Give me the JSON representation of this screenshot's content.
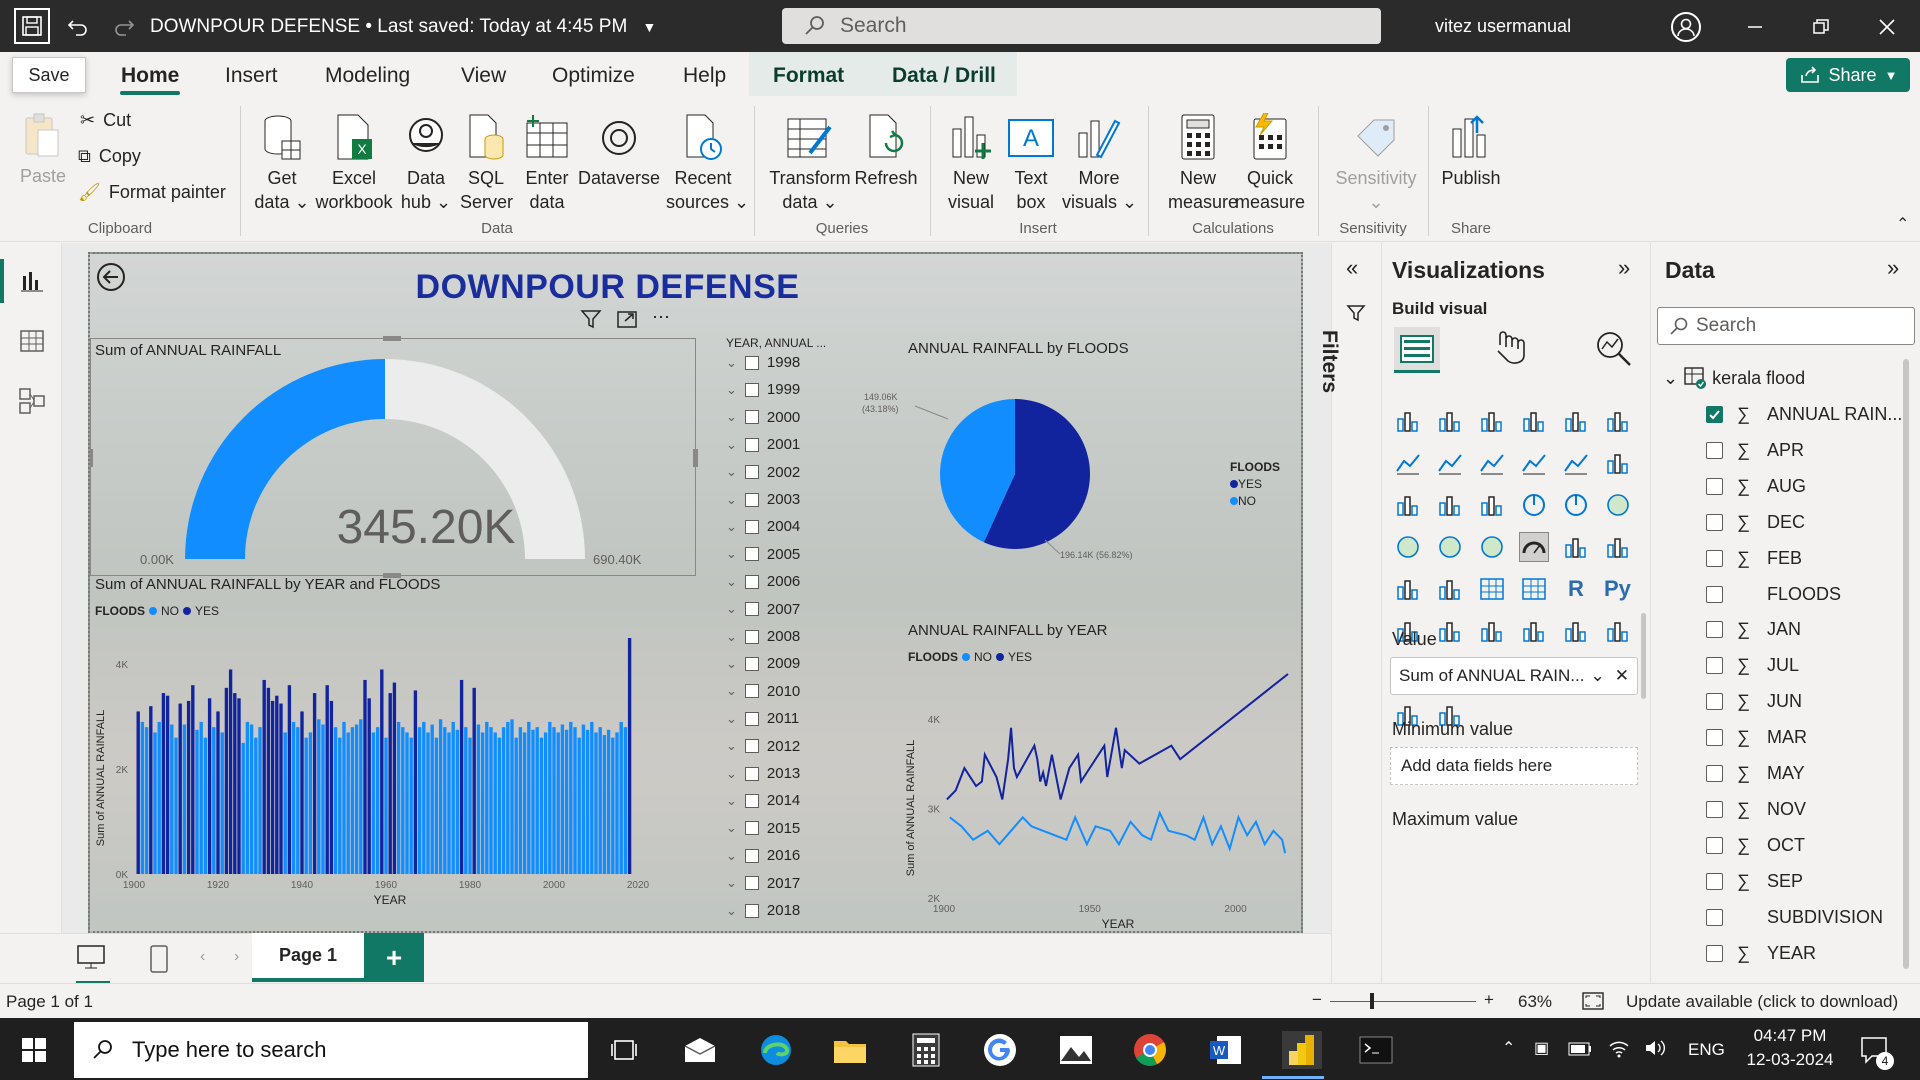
{
  "titlebar": {
    "doc_title": "DOWNPOUR DEFENSE",
    "saved_status": "Last saved: Today at 4:45 PM",
    "search_placeholder": "Search",
    "user_name": "vitez usermanual",
    "save_tooltip": "Save"
  },
  "menu": {
    "tabs": [
      "Home",
      "Insert",
      "Modeling",
      "View",
      "Optimize",
      "Help",
      "Format",
      "Data / Drill"
    ],
    "active": "Home",
    "share_label": "Share"
  },
  "ribbon": {
    "clipboard": {
      "paste": "Paste",
      "cut": "Cut",
      "copy": "Copy",
      "format_painter": "Format painter",
      "group": "Clipboard"
    },
    "data": {
      "get_data": [
        "Get",
        "data"
      ],
      "excel": [
        "Excel",
        "workbook"
      ],
      "data_hub": [
        "Data",
        "hub"
      ],
      "sql": [
        "SQL",
        "Server"
      ],
      "enter_data": [
        "Enter",
        "data"
      ],
      "dataverse": "Dataverse",
      "recent": [
        "Recent",
        "sources"
      ],
      "group": "Data"
    },
    "queries": {
      "transform": [
        "Transform",
        "data"
      ],
      "refresh": "Refresh",
      "group": "Queries"
    },
    "insert": {
      "new_visual": [
        "New",
        "visual"
      ],
      "text_box": [
        "Text",
        "box"
      ],
      "more_visuals": [
        "More",
        "visuals"
      ],
      "group": "Insert"
    },
    "calculations": {
      "new_measure": [
        "New",
        "measure"
      ],
      "quick_measure": [
        "Quick",
        "measure"
      ],
      "group": "Calculations"
    },
    "sensitivity": {
      "label": "Sensitivity",
      "group": "Sensitivity"
    },
    "share": {
      "publish": "Publish",
      "group": "Share"
    }
  },
  "report": {
    "title": "DOWNPOUR DEFENSE",
    "gauge": {
      "title": "Sum of ANNUAL RAINFALL",
      "value_label": "345.20K",
      "min_label": "0.00K",
      "max_label": "690.40K",
      "value": 345.2,
      "max": 690.4
    },
    "bar_chart_title": "Sum of ANNUAL RAINFALL by YEAR and FLOODS",
    "bar_legend": {
      "title": "FLOODS",
      "items": [
        "NO",
        "YES"
      ]
    },
    "slicer": {
      "title": "YEAR, ANNUAL ...",
      "years": [
        "1998",
        "1999",
        "2000",
        "2001",
        "2002",
        "2003",
        "2004",
        "2005",
        "2006",
        "2007",
        "2008",
        "2009",
        "2010",
        "2011",
        "2012",
        "2013",
        "2014",
        "2015",
        "2016",
        "2017",
        "2018"
      ]
    },
    "pie_title": "ANNUAL RAINFALL by FLOODS",
    "pie_legend": {
      "title": "FLOODS",
      "items": [
        "YES",
        "NO"
      ]
    },
    "line_chart_title": "ANNUAL RAINFALL by YEAR",
    "line_legend": {
      "title": "FLOODS",
      "items": [
        "NO",
        "YES"
      ]
    }
  },
  "chart_data": [
    {
      "type": "bar",
      "title": "Sum of ANNUAL RAINFALL by YEAR and FLOODS",
      "xlabel": "YEAR",
      "ylabel": "Sum of ANNUAL RAINFALL",
      "x_ticks": [
        "1900",
        "1920",
        "1940",
        "1960",
        "1980",
        "2000",
        "2020"
      ],
      "y_ticks": [
        "0K",
        "2K",
        "4K"
      ],
      "xlim": [
        1900,
        2020
      ],
      "ylim": [
        0,
        4500
      ],
      "series": [
        {
          "name": "NO",
          "color": "#118dff",
          "x": [
            1902,
            1903,
            1905,
            1906,
            1909,
            1910,
            1912,
            1915,
            1916,
            1917,
            1919,
            1921,
            1926,
            1927,
            1928,
            1929,
            1930,
            1936,
            1938,
            1939,
            1941,
            1942,
            1944,
            1945,
            1948,
            1949,
            1950,
            1951,
            1952,
            1953,
            1954,
            1957,
            1958,
            1960,
            1963,
            1964,
            1965,
            1966,
            1968,
            1969,
            1970,
            1971,
            1972,
            1973,
            1974,
            1975,
            1976,
            1977,
            1979,
            1980,
            1982,
            1983,
            1984,
            1985,
            1986,
            1987,
            1988,
            1989,
            1990,
            1991,
            1992,
            1993,
            1994,
            1995,
            1996,
            1997,
            1998,
            1999,
            2000,
            2001,
            2002,
            2003,
            2004,
            2005,
            2006,
            2007,
            2008,
            2009,
            2010,
            2011,
            2012,
            2013,
            2014,
            2015,
            2016,
            2017
          ],
          "values": [
            2900,
            2800,
            2700,
            2900,
            2850,
            2600,
            2850,
            2750,
            2900,
            2600,
            2800,
            2700,
            2500,
            2900,
            2850,
            2600,
            2800,
            2700,
            2900,
            2800,
            2600,
            2700,
            2950,
            2850,
            2800,
            2600,
            2900,
            2700,
            2800,
            2850,
            2950,
            2700,
            2800,
            2600,
            2900,
            2800,
            2700,
            2600,
            2800,
            2900,
            2700,
            2850,
            2600,
            2950,
            2800,
            2700,
            2900,
            2750,
            2800,
            2600,
            2850,
            2700,
            2900,
            2800,
            2700,
            2600,
            2800,
            2900,
            2950,
            2600,
            2800,
            2700,
            2900,
            2750,
            2800,
            2600,
            2700,
            2900,
            2800,
            2700,
            2850,
            2750,
            2900,
            2800,
            2600,
            2850,
            2750,
            2900,
            2700,
            2800,
            2650,
            2750,
            2600,
            2700,
            2900,
            2800
          ]
        },
        {
          "name": "YES",
          "color": "#12239e",
          "x": [
            1901,
            1904,
            1907,
            1908,
            1911,
            1913,
            1914,
            1918,
            1920,
            1922,
            1923,
            1924,
            1925,
            1931,
            1932,
            1933,
            1934,
            1935,
            1937,
            1940,
            1943,
            1946,
            1947,
            1955,
            1956,
            1959,
            1961,
            1962,
            1967,
            1978,
            1981,
            2018
          ],
          "values": [
            3100,
            3200,
            3450,
            3400,
            3250,
            3300,
            3600,
            3350,
            3100,
            3550,
            3900,
            3450,
            3350,
            3700,
            3550,
            3300,
            3400,
            3250,
            3600,
            3100,
            3450,
            3600,
            3300,
            3700,
            3350,
            3900,
            3450,
            3650,
            3500,
            3700,
            3550,
            4500
          ]
        }
      ]
    },
    {
      "type": "pie",
      "title": "ANNUAL RAINFALL by FLOODS",
      "categories": [
        "YES",
        "NO"
      ],
      "values": [
        196.14,
        149.06
      ],
      "labels": [
        "196.14K (56.82%)",
        "149.06K (43.18%)"
      ],
      "colors": [
        "#12239e",
        "#118dff"
      ],
      "legend": "right"
    },
    {
      "type": "line",
      "title": "ANNUAL RAINFALL by YEAR",
      "xlabel": "YEAR",
      "ylabel": "Sum of ANNUAL RAINFALL",
      "x_ticks": [
        "1900",
        "1950",
        "2000"
      ],
      "y_ticks": [
        "2K",
        "3K",
        "4K"
      ],
      "xlim": [
        1900,
        2018
      ],
      "ylim": [
        2000,
        4500
      ],
      "series": [
        {
          "name": "YES",
          "color": "#12239e",
          "x": [
            1901,
            1904,
            1907,
            1908,
            1911,
            1913,
            1914,
            1918,
            1920,
            1922,
            1923,
            1924,
            1925,
            1931,
            1932,
            1933,
            1934,
            1935,
            1937,
            1940,
            1943,
            1946,
            1947,
            1955,
            1956,
            1959,
            1961,
            1962,
            1967,
            1978,
            1981,
            2018
          ],
          "values": [
            3100,
            3200,
            3450,
            3400,
            3250,
            3300,
            3600,
            3350,
            3100,
            3550,
            3900,
            3450,
            3350,
            3700,
            3550,
            3300,
            3400,
            3250,
            3600,
            3100,
            3450,
            3600,
            3300,
            3700,
            3350,
            3900,
            3450,
            3650,
            3500,
            3700,
            3550,
            4500
          ]
        },
        {
          "name": "NO",
          "color": "#118dff",
          "x": [
            1902,
            1906,
            1910,
            1915,
            1919,
            1927,
            1930,
            1938,
            1942,
            1945,
            1949,
            1952,
            1957,
            1960,
            1964,
            1968,
            1971,
            1974,
            1977,
            1983,
            1986,
            1989,
            1992,
            1995,
            1998,
            2001,
            2004,
            2007,
            2010,
            2013,
            2016,
            2017
          ],
          "values": [
            2900,
            2800,
            2650,
            2750,
            2600,
            2900,
            2800,
            2700,
            2650,
            2900,
            2600,
            2800,
            2750,
            2600,
            2850,
            2700,
            2650,
            2950,
            2750,
            2700,
            2650,
            2900,
            2600,
            2800,
            2550,
            2900,
            2700,
            2850,
            2600,
            2750,
            2650,
            2500
          ]
        }
      ]
    },
    {
      "type": "gauge",
      "title": "Sum of ANNUAL RAINFALL",
      "value": 345.2,
      "min": 0,
      "max": 690.4,
      "unit": "K"
    }
  ],
  "visualizations": {
    "title": "Visualizations",
    "build_visual": "Build visual",
    "value_label": "Value",
    "value_field": "Sum of ANNUAL RAIN...",
    "min_label": "Minimum value",
    "add_fields": "Add data fields here",
    "max_label": "Maximum value"
  },
  "filters_label": "Filters",
  "data_pane": {
    "title": "Data",
    "search_placeholder": "Search",
    "table": "kerala flood",
    "fields": [
      {
        "name": "ANNUAL RAIN...",
        "sigma": true,
        "checked": true
      },
      {
        "name": "APR",
        "sigma": true,
        "checked": false
      },
      {
        "name": "AUG",
        "sigma": true,
        "checked": false
      },
      {
        "name": "DEC",
        "sigma": true,
        "checked": false
      },
      {
        "name": "FEB",
        "sigma": true,
        "checked": false
      },
      {
        "name": "FLOODS",
        "sigma": false,
        "checked": false
      },
      {
        "name": "JAN",
        "sigma": true,
        "checked": false
      },
      {
        "name": "JUL",
        "sigma": true,
        "checked": false
      },
      {
        "name": "JUN",
        "sigma": true,
        "checked": false
      },
      {
        "name": "MAR",
        "sigma": true,
        "checked": false
      },
      {
        "name": "MAY",
        "sigma": true,
        "checked": false
      },
      {
        "name": "NOV",
        "sigma": true,
        "checked": false
      },
      {
        "name": "OCT",
        "sigma": true,
        "checked": false
      },
      {
        "name": "SEP",
        "sigma": true,
        "checked": false
      },
      {
        "name": "SUBDIVISION",
        "sigma": false,
        "checked": false
      },
      {
        "name": "YEAR",
        "sigma": true,
        "checked": false
      }
    ]
  },
  "pages": {
    "current": "Page 1",
    "status": "Page 1 of 1"
  },
  "statusbar": {
    "zoom": "63%",
    "update": "Update available (click to download)"
  },
  "taskbar": {
    "search_placeholder": "Type here to search",
    "lang": "ENG",
    "time": "04:47 PM",
    "date": "12-03-2024",
    "notif_count": "4"
  }
}
